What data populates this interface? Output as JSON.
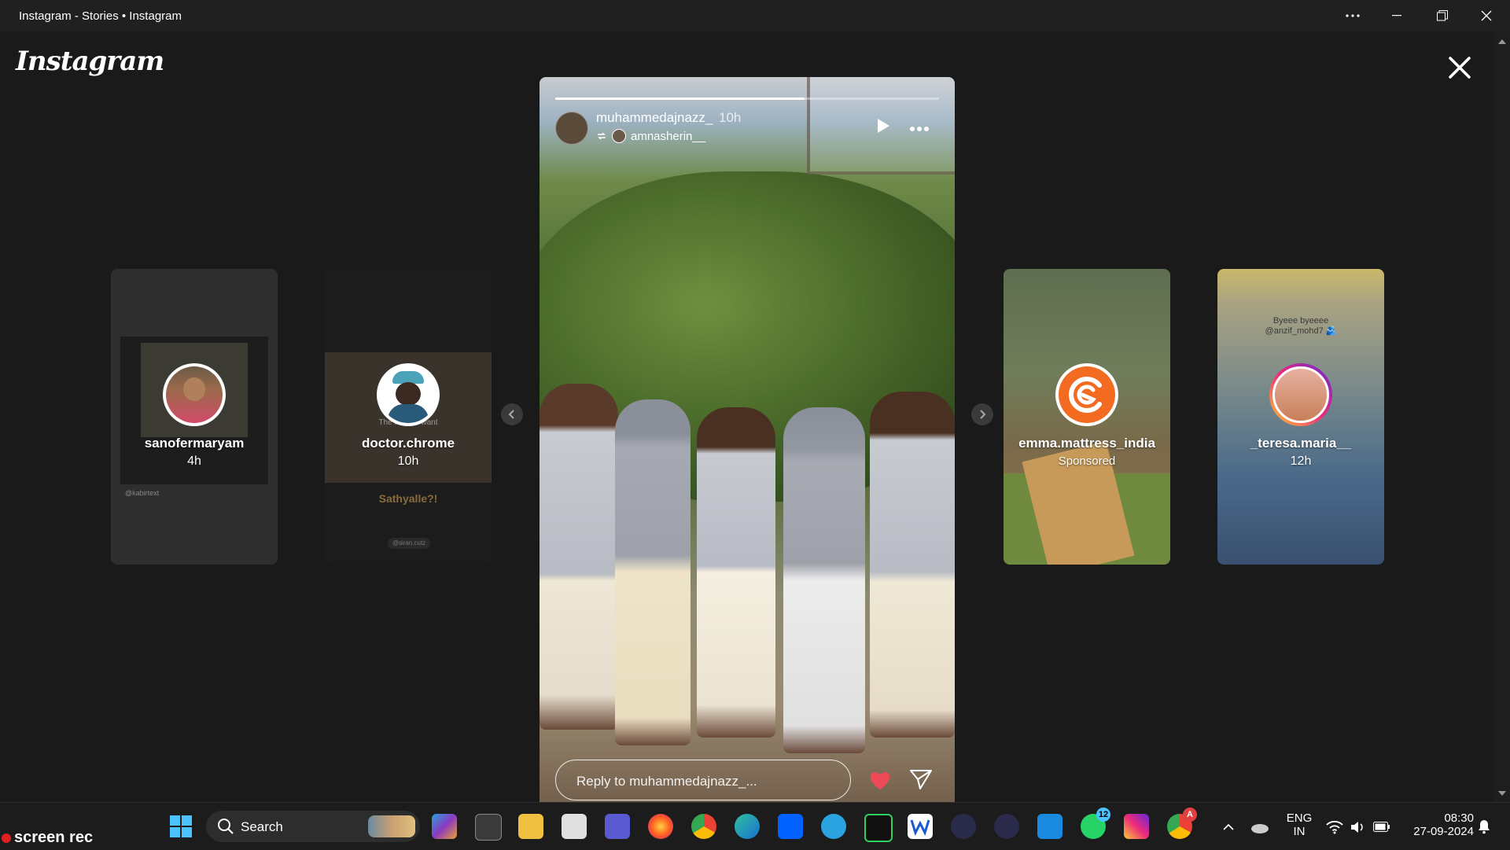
{
  "window": {
    "title": "Instagram - Stories • Instagram"
  },
  "logo": {
    "text": "Instagram"
  },
  "side_stories": [
    {
      "username": "sanofermaryam",
      "time": "4h"
    },
    {
      "username": "doctor.chrome",
      "time": "10h",
      "overlay_top": "The father I want",
      "caption": "Sathyalle?!",
      "tag": "@siran.cutz"
    },
    {
      "username": "emma.mattress_india",
      "time": "Sponsored"
    },
    {
      "username": "_teresa.maria__",
      "time": "12h",
      "overlay_top": "Byeee byeeee\n@anzif_mohd7 🫂"
    }
  ],
  "side_small_text": {
    "left_tag": "@kabirtext"
  },
  "story": {
    "username": "muhammedajnazz_",
    "time": "10h",
    "reposted_from": "amnasherin__",
    "progress": 0.65,
    "reply_placeholder": "Reply to muhammedajnazz_..."
  },
  "taskbar": {
    "search_label": "Search",
    "whatsapp_badge": "12",
    "chrome_badge": "A",
    "lang_top": "ENG",
    "lang_bottom": "IN",
    "time": "08:30",
    "date": "27-09-2024"
  },
  "watermark": {
    "text": "screen rec"
  },
  "colors": {
    "bg": "#1a1a1a",
    "titlebar": "#202020",
    "heart": "#ed4956",
    "emma_orange": "#f26b21"
  }
}
